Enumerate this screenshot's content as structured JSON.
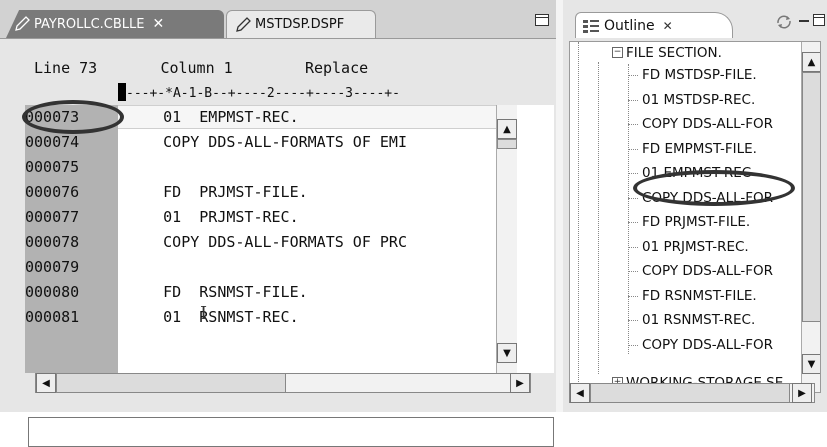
{
  "editor": {
    "tabs": [
      {
        "label": "PAYROLLC.CBLLE",
        "close": "✕"
      },
      {
        "label": "MSTDSP.DSPF"
      }
    ],
    "status": {
      "line_label": "Line 73",
      "column_label": "Column 1",
      "mode": "Replace"
    },
    "ruler": "---+-*A-1-B--+----2----+----3----+-",
    "lines": [
      {
        "num": "000073",
        "text": "     01  EMPMST-REC."
      },
      {
        "num": "000074",
        "text": "     COPY DDS-ALL-FORMATS OF EMI"
      },
      {
        "num": "000075",
        "text": ""
      },
      {
        "num": "000076",
        "text": "     FD  PRJMST-FILE."
      },
      {
        "num": "000077",
        "text": "     01  PRJMST-REC."
      },
      {
        "num": "000078",
        "text": "     COPY DDS-ALL-FORMATS OF PRC"
      },
      {
        "num": "000079",
        "text": ""
      },
      {
        "num": "000080",
        "text": "     FD  RSNMST-FILE."
      },
      {
        "num": "000081",
        "text": "     01  RSNMST-REC."
      }
    ],
    "command_value": ""
  },
  "outline": {
    "title": "Outline",
    "close": "✕",
    "root": "FILE SECTION.",
    "items": [
      "FD  MSTDSP-FILE.",
      "01  MSTDSP-REC.",
      "COPY DDS-ALL-FOR",
      "FD  EMPMST-FILE.",
      "01  EMPMST-REC",
      "COPY DDS-ALL-FOR",
      "FD  PRJMST-FILE.",
      "01  PRJMST-REC.",
      "COPY DDS-ALL-FOR",
      "FD  RSNMST-FILE.",
      "01  RSNMST-REC.",
      "COPY DDS-ALL-FOR"
    ],
    "next_section": "WORKING-STORAGE SE"
  },
  "icons": [
    "pencil-icon",
    "close-icon",
    "maximize-icon",
    "outline-icon",
    "sync-icon",
    "minimize-icon",
    "collapse-icon",
    "expand-icon",
    "scroll-up-icon",
    "scroll-down-icon",
    "scroll-left-icon",
    "scroll-right-icon"
  ],
  "colors": {
    "gutter": "#b2b2b2",
    "active_tab": "#7a7a7a",
    "highlight_oval": "#333333"
  }
}
